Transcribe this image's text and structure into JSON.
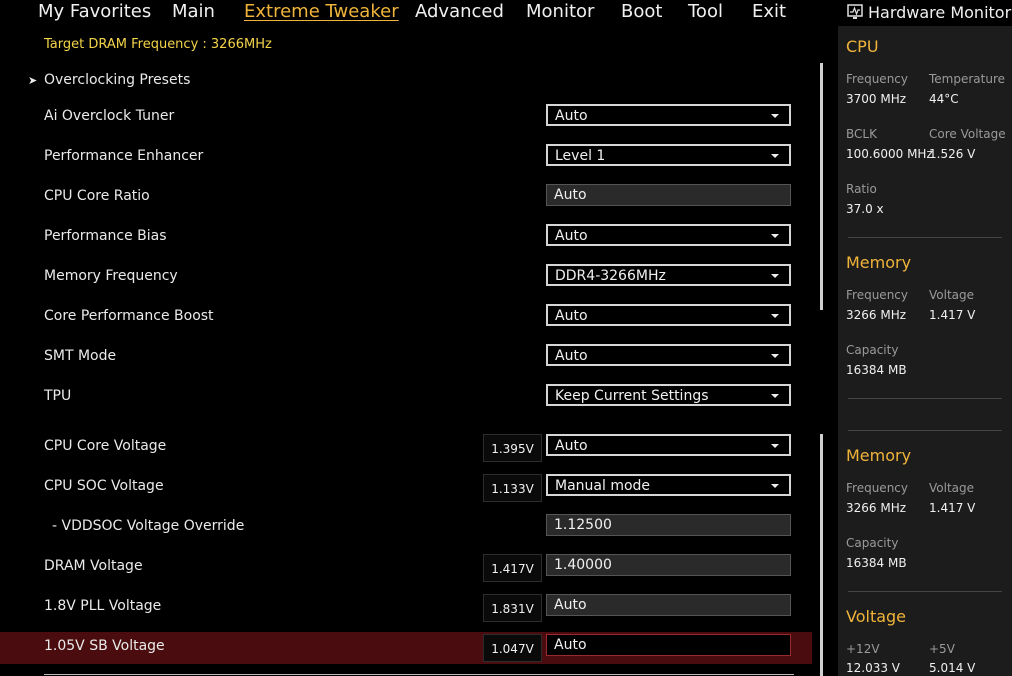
{
  "nav": {
    "tabs": [
      "My Favorites",
      "Main",
      "Extreme Tweaker",
      "Advanced",
      "Monitor",
      "Boot",
      "Tool",
      "Exit"
    ],
    "active": "Extreme Tweaker"
  },
  "main": {
    "target_dram": "Target DRAM Frequency : 3266MHz",
    "presets_label": "Overclocking Presets",
    "rows": [
      {
        "label": "Ai Overclock Tuner",
        "value": "Auto",
        "type": "select"
      },
      {
        "label": "Performance Enhancer",
        "value": "Level 1",
        "type": "select"
      },
      {
        "label": "CPU Core Ratio",
        "value": "Auto",
        "type": "input"
      },
      {
        "label": "Performance Bias",
        "value": "Auto",
        "type": "select"
      },
      {
        "label": "Memory Frequency",
        "value": "DDR4-3266MHz",
        "type": "select"
      },
      {
        "label": "Core Performance Boost",
        "value": "Auto",
        "type": "select"
      },
      {
        "label": "SMT Mode",
        "value": "Auto",
        "type": "select"
      },
      {
        "label": "TPU",
        "value": "Keep Current Settings",
        "type": "select"
      },
      {
        "label": "CPU Core Voltage",
        "voltage": "1.395V",
        "value": "Auto",
        "type": "select"
      },
      {
        "label": "CPU SOC Voltage",
        "voltage": "1.133V",
        "value": "Manual mode",
        "type": "select"
      },
      {
        "label": "- VDDSOC Voltage Override",
        "value": "1.12500",
        "type": "input"
      },
      {
        "label": "DRAM Voltage",
        "voltage": "1.417V",
        "value": "1.40000",
        "type": "input"
      },
      {
        "label": "1.8V PLL Voltage",
        "voltage": "1.831V",
        "value": "Auto",
        "type": "input"
      },
      {
        "label": "1.05V SB Voltage",
        "voltage": "1.047V",
        "value": "Auto",
        "type": "input",
        "highlighted": true
      }
    ]
  },
  "hwmon": {
    "title": "Hardware Monitor",
    "cpu": {
      "title": "CPU",
      "frequency_label": "Frequency",
      "frequency": "3700 MHz",
      "temperature_label": "Temperature",
      "temperature": "44°C",
      "bclk_label": "BCLK",
      "bclk": "100.6000 MHz",
      "core_voltage_label": "Core Voltage",
      "core_voltage": "1.526 V",
      "ratio_label": "Ratio",
      "ratio": "37.0 x"
    },
    "memory1": {
      "title": "Memory",
      "frequency_label": "Frequency",
      "frequency": "3266 MHz",
      "voltage_label": "Voltage",
      "voltage": "1.417 V",
      "capacity_label": "Capacity",
      "capacity": "16384 MB"
    },
    "memory2": {
      "title": "Memory",
      "frequency_label": "Frequency",
      "frequency": "3266 MHz",
      "voltage_label": "Voltage",
      "voltage": "1.417 V",
      "capacity_label": "Capacity",
      "capacity": "16384 MB"
    },
    "voltage": {
      "title": "Voltage",
      "v12_label": "+12V",
      "v12": "12.033 V",
      "v5_label": "+5V",
      "v5": "5.014 V"
    }
  }
}
